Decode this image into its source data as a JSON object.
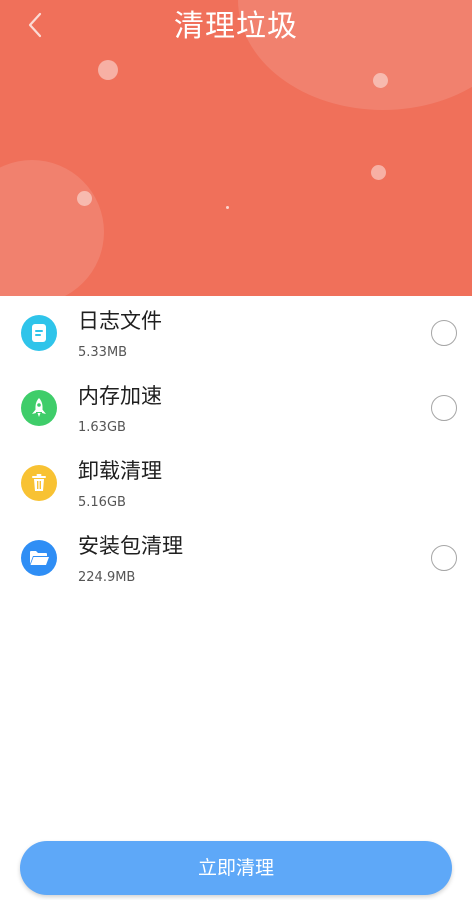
{
  "header": {
    "title": "清理垃圾",
    "background_color": "#f0705a",
    "back_icon": "chevron-left-icon"
  },
  "items": [
    {
      "name": "日志文件",
      "size": "5.33MB",
      "icon": "document-icon",
      "icon_color": "#2fc4ea",
      "has_radio": true,
      "checked": false
    },
    {
      "name": "内存加速",
      "size": "1.63GB",
      "icon": "rocket-icon",
      "icon_color": "#3fcd6a",
      "has_radio": true,
      "checked": false
    },
    {
      "name": "卸载清理",
      "size": "5.16GB",
      "icon": "trash-icon",
      "icon_color": "#f8c233",
      "has_radio": false,
      "checked": false
    },
    {
      "name": "安装包清理",
      "size": "224.9MB",
      "icon": "folder-icon",
      "icon_color": "#2f8ef5",
      "has_radio": true,
      "checked": false
    }
  ],
  "action": {
    "label": "立即清理",
    "color": "#5ea8f8"
  }
}
